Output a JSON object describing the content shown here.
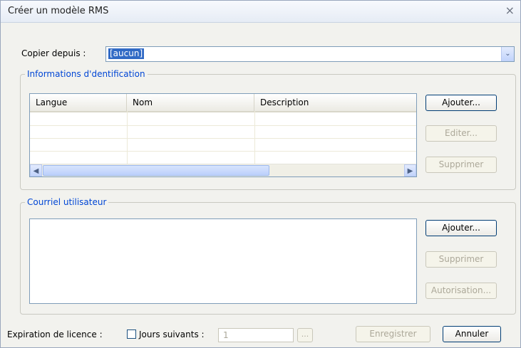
{
  "window": {
    "title": "Créer un modèle RMS",
    "close_glyph": "×"
  },
  "copy_from": {
    "label": "Copier depuis :",
    "value": "[aucun]",
    "dropdown_glyph": "⌄"
  },
  "identification": {
    "legend": "Informations d'dentification",
    "columns": [
      "Langue",
      "Nom",
      "Description"
    ],
    "rows": [],
    "buttons": {
      "add": "Ajouter...",
      "edit": "Editer...",
      "delete": "Supprimer"
    },
    "scroll_left_glyph": "◀",
    "scroll_right_glyph": "▶"
  },
  "user_email": {
    "legend": "Courriel utilisateur",
    "items": [],
    "buttons": {
      "add": "Ajouter...",
      "delete": "Supprimer",
      "authorize": "Autorisation..."
    }
  },
  "expiration": {
    "label": "Expiration de licence :",
    "days_checkbox_label": "Jours suivants :",
    "days_checked": false,
    "days_value": "1",
    "browse_label": "..."
  },
  "footer": {
    "save": "Enregistrer",
    "cancel": "Annuler"
  },
  "colors": {
    "legend": "#0046d5",
    "selection": "#316ac5",
    "button_border": "#003c74"
  }
}
